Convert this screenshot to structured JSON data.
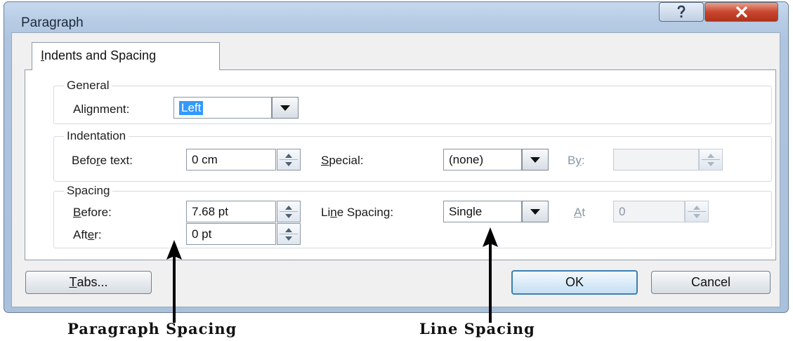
{
  "window": {
    "title": "Paragraph"
  },
  "tabs": [
    {
      "label": "Indents and Spacing",
      "mnemonic": "I",
      "rest": "ndents and Spacing"
    }
  ],
  "general": {
    "legend": "General",
    "alignment_label_pre": "Ali",
    "alignment_label_key": "g",
    "alignment_label_post": "nment:",
    "alignment_value": "Left"
  },
  "indentation": {
    "legend": "Indentation",
    "before_label_pre": "Befo",
    "before_label_key": "r",
    "before_label_post": "e text:",
    "before_value": "0 cm",
    "special_label_key": "S",
    "special_label_post": "pecial:",
    "special_value": "(none)",
    "by_label_pre": "B",
    "by_label_key": "y",
    "by_label_post": ":",
    "by_value": ""
  },
  "spacing": {
    "legend": "Spacing",
    "before_label_key": "B",
    "before_label_post": "efore:",
    "before_value": "7.68 pt",
    "after_label_pre": "Aft",
    "after_label_key": "e",
    "after_label_post": "r:",
    "after_value": "0 pt",
    "line_label_pre": "Li",
    "line_label_key": "n",
    "line_label_post": "e Spacing:",
    "line_value": "Single",
    "at_label_key": "A",
    "at_label_post": "t",
    "at_value": "0"
  },
  "buttons": {
    "tabs_key": "T",
    "tabs_post": "abs...",
    "ok": "OK",
    "cancel": "Cancel"
  },
  "captions": {
    "paragraph_spacing": "Paragraph Spacing",
    "line_spacing": "Line Spacing"
  },
  "icons": {
    "help": "help-icon",
    "close": "close-icon",
    "dropdown": "chevron-down-icon",
    "spinner": "spinner-icon",
    "arrow": "arrow-up-icon"
  },
  "colors": {
    "titlebar": "#b6cbe4",
    "close_button": "#c8462f",
    "selection": "#3399ff",
    "ok_border": "#3c7fb1"
  }
}
